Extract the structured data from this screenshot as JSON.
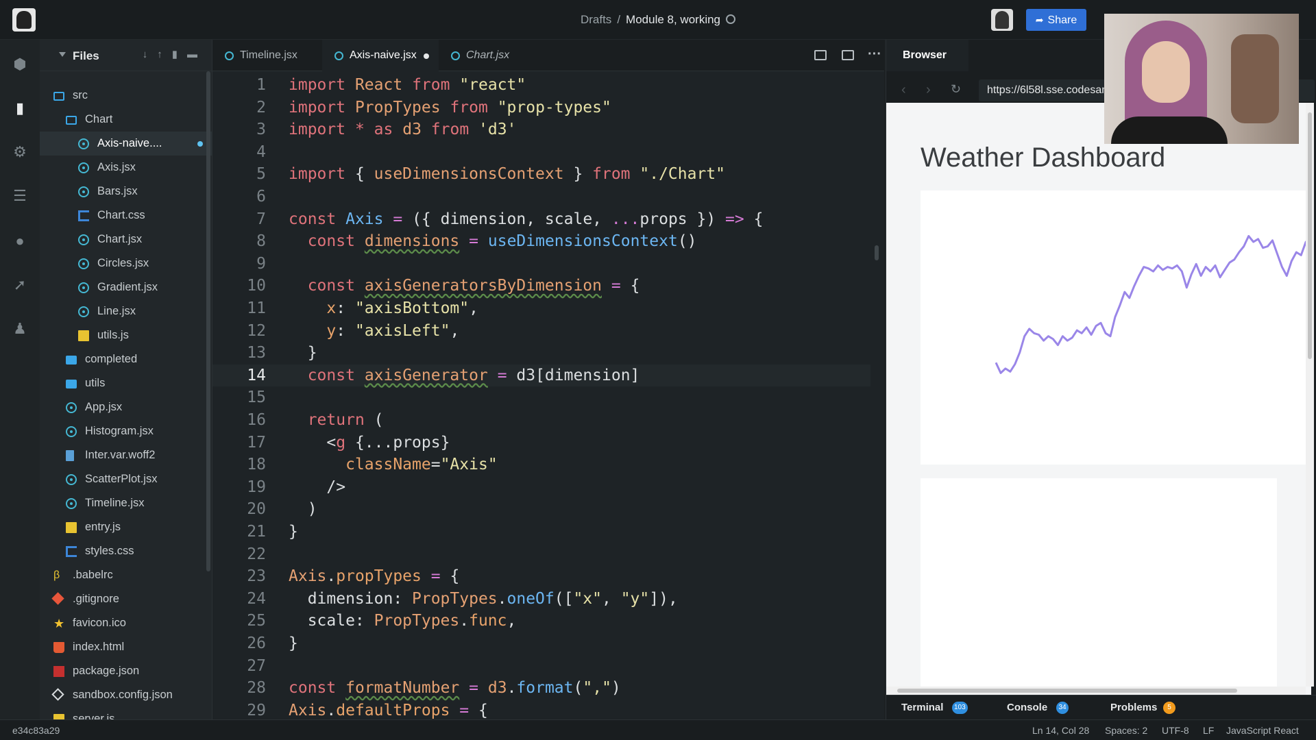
{
  "topbar": {
    "breadcrumb_parent": "Drafts",
    "breadcrumb_separator": "/",
    "breadcrumb_current": "Module 8, working",
    "share_label": "Share"
  },
  "activity_bar": [
    "cube-icon",
    "file-icon",
    "gear-icon",
    "server-icon",
    "github-icon",
    "rocket-icon",
    "users-icon"
  ],
  "explorer": {
    "title": "Files",
    "items": [
      {
        "label": "src",
        "icon": "folder-open",
        "indent": 0
      },
      {
        "label": "Chart",
        "icon": "folder-open",
        "indent": 1
      },
      {
        "label": "Axis-naive....",
        "icon": "react",
        "indent": 2,
        "selected": true,
        "modified": true
      },
      {
        "label": "Axis.jsx",
        "icon": "react",
        "indent": 2
      },
      {
        "label": "Bars.jsx",
        "icon": "react",
        "indent": 2
      },
      {
        "label": "Chart.css",
        "icon": "css",
        "indent": 2
      },
      {
        "label": "Chart.jsx",
        "icon": "react",
        "indent": 2
      },
      {
        "label": "Circles.jsx",
        "icon": "react",
        "indent": 2
      },
      {
        "label": "Gradient.jsx",
        "icon": "react",
        "indent": 2
      },
      {
        "label": "Line.jsx",
        "icon": "react",
        "indent": 2
      },
      {
        "label": "utils.js",
        "icon": "js",
        "indent": 2
      },
      {
        "label": "completed",
        "icon": "folder",
        "indent": 1
      },
      {
        "label": "utils",
        "icon": "folder",
        "indent": 1
      },
      {
        "label": "App.jsx",
        "icon": "react",
        "indent": 1
      },
      {
        "label": "Histogram.jsx",
        "icon": "react",
        "indent": 1
      },
      {
        "label": "Inter.var.woff2",
        "icon": "file",
        "indent": 1
      },
      {
        "label": "ScatterPlot.jsx",
        "icon": "react",
        "indent": 1
      },
      {
        "label": "Timeline.jsx",
        "icon": "react",
        "indent": 1
      },
      {
        "label": "entry.js",
        "icon": "js",
        "indent": 1
      },
      {
        "label": "styles.css",
        "icon": "css",
        "indent": 1
      },
      {
        "label": ".babelrc",
        "icon": "babel",
        "indent": 0
      },
      {
        "label": ".gitignore",
        "icon": "git",
        "indent": 0
      },
      {
        "label": "favicon.ico",
        "icon": "star",
        "indent": 0
      },
      {
        "label": "index.html",
        "icon": "html",
        "indent": 0
      },
      {
        "label": "package.json",
        "icon": "npm",
        "indent": 0
      },
      {
        "label": "sandbox.config.json",
        "icon": "box",
        "indent": 0
      },
      {
        "label": "server.js",
        "icon": "js",
        "indent": 0
      }
    ]
  },
  "editor": {
    "tabs": [
      {
        "label": "Timeline.jsx",
        "active": false,
        "italic": false,
        "modified": false
      },
      {
        "label": "Axis-naive.jsx",
        "active": true,
        "italic": false,
        "modified": true
      },
      {
        "label": "Chart.jsx",
        "active": false,
        "italic": true,
        "modified": false
      }
    ],
    "current_line": 14,
    "lines": [
      [
        [
          "kw",
          "import"
        ],
        [
          "t",
          " "
        ],
        [
          "cls",
          "React"
        ],
        [
          "t",
          " "
        ],
        [
          "kw",
          "from"
        ],
        [
          "t",
          " "
        ],
        [
          "str",
          "\"react\""
        ]
      ],
      [
        [
          "kw",
          "import"
        ],
        [
          "t",
          " "
        ],
        [
          "cls",
          "PropTypes"
        ],
        [
          "t",
          " "
        ],
        [
          "kw",
          "from"
        ],
        [
          "t",
          " "
        ],
        [
          "str",
          "\"prop-types\""
        ]
      ],
      [
        [
          "kw",
          "import"
        ],
        [
          "t",
          " "
        ],
        [
          "kw",
          "*"
        ],
        [
          "t",
          " "
        ],
        [
          "kw",
          "as"
        ],
        [
          "t",
          " "
        ],
        [
          "cls",
          "d3"
        ],
        [
          "t",
          " "
        ],
        [
          "kw",
          "from"
        ],
        [
          "t",
          " "
        ],
        [
          "str",
          "'d3'"
        ]
      ],
      [],
      [
        [
          "kw",
          "import"
        ],
        [
          "t",
          " { "
        ],
        [
          "cls",
          "useDimensionsContext"
        ],
        [
          "t",
          " } "
        ],
        [
          "kw",
          "from"
        ],
        [
          "t",
          " "
        ],
        [
          "str",
          "\"./Chart\""
        ]
      ],
      [],
      [
        [
          "kw",
          "const"
        ],
        [
          "t",
          " "
        ],
        [
          "fn",
          "Axis"
        ],
        [
          "t",
          " "
        ],
        [
          "op",
          "="
        ],
        [
          "t",
          " ({ dimension, scale, "
        ],
        [
          "op",
          "..."
        ],
        [
          "t",
          "props }) "
        ],
        [
          "op",
          "=>"
        ],
        [
          "t",
          " {"
        ]
      ],
      [
        [
          "t",
          "  "
        ],
        [
          "kw",
          "const"
        ],
        [
          "t",
          " "
        ],
        [
          "var",
          "dimensions"
        ],
        [
          "t",
          " "
        ],
        [
          "op",
          "="
        ],
        [
          "t",
          " "
        ],
        [
          "fn",
          "useDimensionsContext"
        ],
        [
          "t",
          "()"
        ]
      ],
      [],
      [
        [
          "t",
          "  "
        ],
        [
          "kw",
          "const"
        ],
        [
          "t",
          " "
        ],
        [
          "var",
          "axisGeneratorsByDimension"
        ],
        [
          "t",
          " "
        ],
        [
          "op",
          "="
        ],
        [
          "t",
          " {"
        ]
      ],
      [
        [
          "t",
          "    "
        ],
        [
          "prop",
          "x"
        ],
        [
          "t",
          ": "
        ],
        [
          "str",
          "\"axisBottom\""
        ],
        [
          "t",
          ","
        ]
      ],
      [
        [
          "t",
          "    "
        ],
        [
          "prop",
          "y"
        ],
        [
          "t",
          ": "
        ],
        [
          "str",
          "\"axisLeft\""
        ],
        [
          "t",
          ","
        ]
      ],
      [
        [
          "t",
          "  }"
        ]
      ],
      [
        [
          "t",
          "  "
        ],
        [
          "kw",
          "const"
        ],
        [
          "t",
          " "
        ],
        [
          "var",
          "axisGenerator"
        ],
        [
          "t",
          " "
        ],
        [
          "op",
          "="
        ],
        [
          "t",
          " d3[dimension]"
        ]
      ],
      [],
      [
        [
          "t",
          "  "
        ],
        [
          "kw",
          "return"
        ],
        [
          "t",
          " ("
        ]
      ],
      [
        [
          "t",
          "    <"
        ],
        [
          "tag",
          "g"
        ],
        [
          "t",
          " {...props}"
        ]
      ],
      [
        [
          "t",
          "      "
        ],
        [
          "prop",
          "className"
        ],
        [
          "t",
          "="
        ],
        [
          "str",
          "\"Axis\""
        ]
      ],
      [
        [
          "t",
          "    />"
        ]
      ],
      [
        [
          "t",
          "  )"
        ]
      ],
      [
        [
          "t",
          "}"
        ]
      ],
      [],
      [
        [
          "cls",
          "Axis"
        ],
        [
          "t",
          "."
        ],
        [
          "prop",
          "propTypes"
        ],
        [
          "t",
          " "
        ],
        [
          "op",
          "="
        ],
        [
          "t",
          " {"
        ]
      ],
      [
        [
          "t",
          "  dimension: "
        ],
        [
          "cls",
          "PropTypes"
        ],
        [
          "t",
          "."
        ],
        [
          "fn",
          "oneOf"
        ],
        [
          "t",
          "(["
        ],
        [
          "str",
          "\"x\""
        ],
        [
          "t",
          ", "
        ],
        [
          "str",
          "\"y\""
        ],
        [
          "t",
          "]),"
        ]
      ],
      [
        [
          "t",
          "  scale: "
        ],
        [
          "cls",
          "PropTypes"
        ],
        [
          "t",
          "."
        ],
        [
          "prop",
          "func"
        ],
        [
          "t",
          ","
        ]
      ],
      [
        [
          "t",
          "}"
        ]
      ],
      [],
      [
        [
          "kw",
          "const"
        ],
        [
          "t",
          " "
        ],
        [
          "var",
          "formatNumber"
        ],
        [
          "t",
          " "
        ],
        [
          "op",
          "="
        ],
        [
          "t",
          " "
        ],
        [
          "cls",
          "d3"
        ],
        [
          "t",
          "."
        ],
        [
          "fn",
          "format"
        ],
        [
          "t",
          "("
        ],
        [
          "str",
          "\",\""
        ],
        [
          "t",
          ")"
        ]
      ],
      [
        [
          "cls",
          "Axis"
        ],
        [
          "t",
          "."
        ],
        [
          "prop",
          "defaultProps"
        ],
        [
          "t",
          " "
        ],
        [
          "op",
          "="
        ],
        [
          "t",
          " {"
        ]
      ]
    ]
  },
  "browser": {
    "tab_label": "Browser",
    "url": "https://6l58l.sse.codesandbox.io/",
    "page_title": "Weather Dashboard",
    "bottom_tabs": [
      {
        "label": "Terminal",
        "count": "103",
        "badge_color": "#2f8fe0"
      },
      {
        "label": "Console",
        "count": "34",
        "badge_color": "#2f8fe0"
      },
      {
        "label": "Problems",
        "count": "5",
        "badge_color": "#f29b1d"
      }
    ]
  },
  "chart_data": {
    "type": "line",
    "title": "",
    "xlabel": "",
    "ylabel": "",
    "line_color": "#9a86e8",
    "y": [
      22,
      8,
      14,
      10,
      20,
      36,
      58,
      68,
      62,
      60,
      52,
      58,
      54,
      46,
      58,
      52,
      56,
      66,
      62,
      70,
      60,
      72,
      76,
      62,
      58,
      84,
      100,
      118,
      110,
      126,
      140,
      152,
      150,
      146,
      154,
      148,
      152,
      150,
      154,
      146,
      124,
      142,
      156,
      140,
      152,
      146,
      154,
      138,
      148,
      158,
      162,
      172,
      180,
      194,
      186,
      190,
      178,
      180,
      188,
      170,
      152,
      140,
      160,
      172,
      168,
      186,
      180,
      192,
      166,
      186
    ]
  },
  "statusbar": {
    "commit": "e34c83a29",
    "cursor": "Ln 14, Col 28",
    "spaces": "Spaces: 2",
    "encoding": "UTF-8",
    "eol": "LF",
    "language": "JavaScript React"
  }
}
